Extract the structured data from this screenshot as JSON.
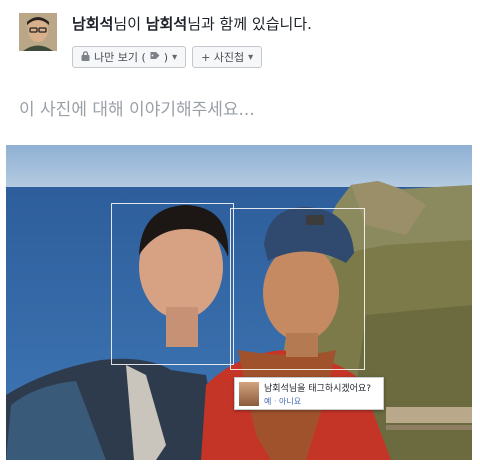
{
  "post": {
    "name1": "남회석",
    "conn1": "님이 ",
    "name2": "남회석",
    "conn2": "님과 함께 있습니다."
  },
  "privacy": {
    "label": "나만 보기 (",
    "suffix": ")",
    "lock_icon": "lock-icon",
    "tag_icon": "tag-icon",
    "caret_icon": "caret-down-icon"
  },
  "album": {
    "label": "+ 사진첩",
    "caret_icon": "caret-down-icon"
  },
  "caption": {
    "placeholder": "이 사진에 대해 이야기해주세요..."
  },
  "tag_suggest": {
    "question": "남회석님을 태그하시겠어요?",
    "yes": "예",
    "sep": " · ",
    "no": "아니요"
  }
}
